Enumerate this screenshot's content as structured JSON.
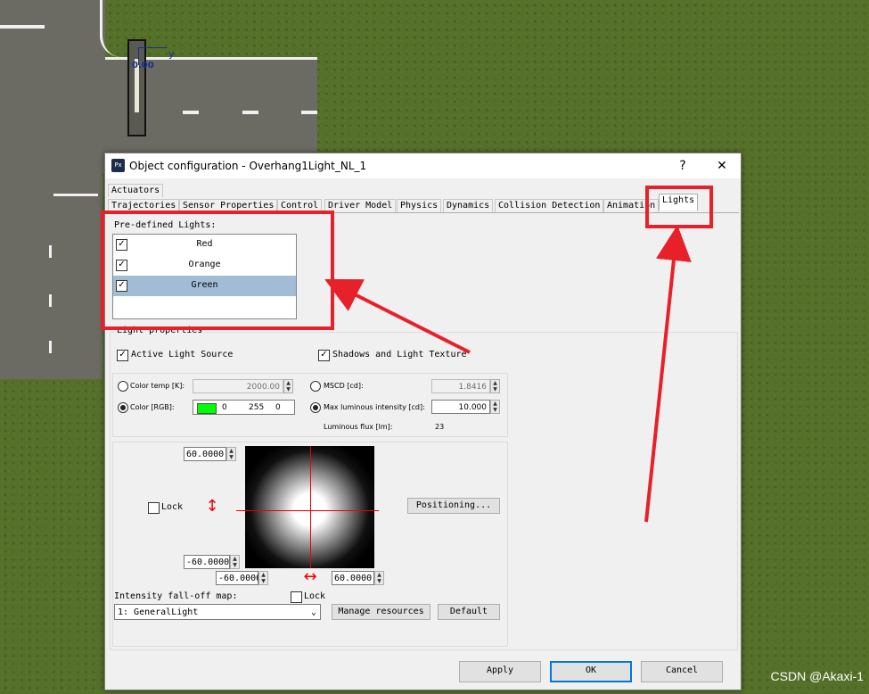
{
  "window": {
    "title": "Object configuration - Overhang1Light_NL_1",
    "app_icon": "Px",
    "help_button": "?",
    "close_button": "✕"
  },
  "scene": {
    "marker_label": "0.00",
    "axis_x": "x",
    "axis_y": "y"
  },
  "tabs": {
    "row1": [
      "Actuators"
    ],
    "row2": [
      "Trajectories",
      "Sensor Properties",
      "Control",
      "Driver Model",
      "Physics",
      "Dynamics",
      "Collision Detection",
      "Animation",
      "Lights"
    ],
    "active": "Lights"
  },
  "predefined": {
    "label": "Pre-defined Lights:",
    "items": [
      {
        "label": "Red",
        "checked": true,
        "selected": false
      },
      {
        "label": "Orange",
        "checked": true,
        "selected": false
      },
      {
        "label": "Green",
        "checked": true,
        "selected": true
      }
    ]
  },
  "light_properties": {
    "group_label": "Light properties",
    "active_light_source": {
      "label": "Active Light Source",
      "checked": true
    },
    "shadows": {
      "label": "Shadows and Light Texture",
      "checked": true
    },
    "color_temp": {
      "label": "Color temp [K]:",
      "value": "2000.00",
      "selected": false
    },
    "color_rgb": {
      "label": "Color [RGB]:",
      "r": "0",
      "g": "255",
      "b": "0",
      "swatch": "#00ff00",
      "selected": true
    },
    "mscd": {
      "label": "MSCD [cd]:",
      "value": "1.8416",
      "selected": false
    },
    "max_luminous": {
      "label": "Max luminous intensity [cd]:",
      "value": "10.000",
      "selected": true
    },
    "luminous_flux": {
      "label": "Luminous flux [lm]:",
      "value": "23"
    }
  },
  "beam": {
    "top_value": "60.0000",
    "bottom_value": "-60.0000",
    "left_value": "-60.0000",
    "right_value": "60.0000",
    "lock_vertical": {
      "label": "Lock",
      "checked": false
    },
    "lock_horizontal": {
      "label": "Lock",
      "checked": false
    },
    "positioning_button": "Positioning..."
  },
  "falloff": {
    "label": "Intensity fall-off map:",
    "selected": "1: GeneralLight",
    "manage_button": "Manage resources",
    "default_button": "Default"
  },
  "footer": {
    "apply": "Apply",
    "ok": "OK",
    "cancel": "Cancel"
  },
  "watermark": "CSDN @Akaxi-1",
  "colors": {
    "annotation_red": "#e8202a",
    "selection": "#a2bcd6",
    "ok_border": "#0078d7"
  }
}
